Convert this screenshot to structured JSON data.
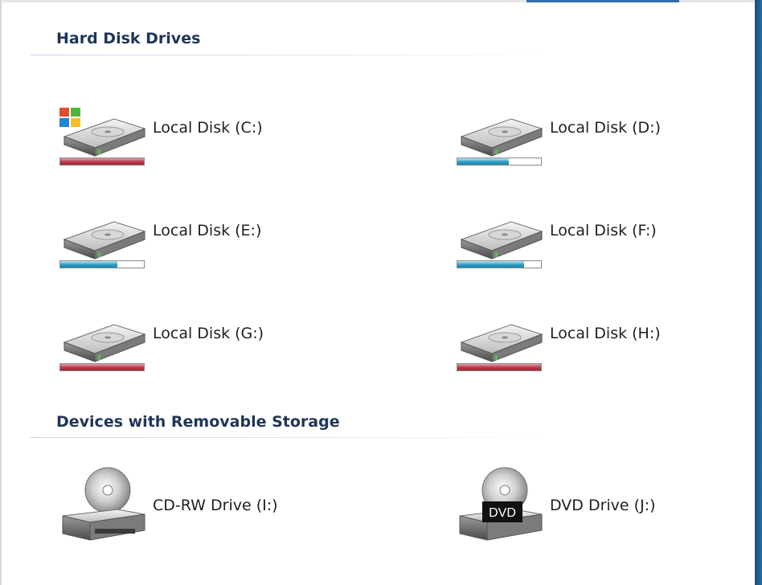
{
  "sections": {
    "hard_disks": {
      "title": "Hard Disk Drives"
    },
    "removable": {
      "title": "Devices with Removable Storage"
    }
  },
  "drives": [
    {
      "label": "Local Disk (C:)",
      "usage_percent": 100,
      "bar_color": "red",
      "icon": "windows-hard-drive-icon"
    },
    {
      "label": "Local Disk (D:)",
      "usage_percent": 62,
      "bar_color": "blue",
      "icon": "hard-drive-icon"
    },
    {
      "label": "Local Disk (E:)",
      "usage_percent": 68,
      "bar_color": "blue",
      "icon": "hard-drive-icon"
    },
    {
      "label": "Local Disk (F:)",
      "usage_percent": 80,
      "bar_color": "blue",
      "icon": "hard-drive-icon"
    },
    {
      "label": "Local Disk (G:)",
      "usage_percent": 100,
      "bar_color": "red",
      "icon": "hard-drive-icon"
    },
    {
      "label": "Local Disk (H:)",
      "usage_percent": 100,
      "bar_color": "red",
      "icon": "hard-drive-icon"
    }
  ],
  "removable": [
    {
      "label": "CD-RW Drive (I:)",
      "icon": "cd-drive-icon"
    },
    {
      "label": "DVD Drive (J:)",
      "icon": "dvd-drive-icon",
      "badge": "DVD"
    }
  ],
  "colors": {
    "bar_red": "#b8374a",
    "bar_blue": "#2c9ec4",
    "header_text": "#1e3657",
    "window_frame": "#2a6aa0"
  }
}
